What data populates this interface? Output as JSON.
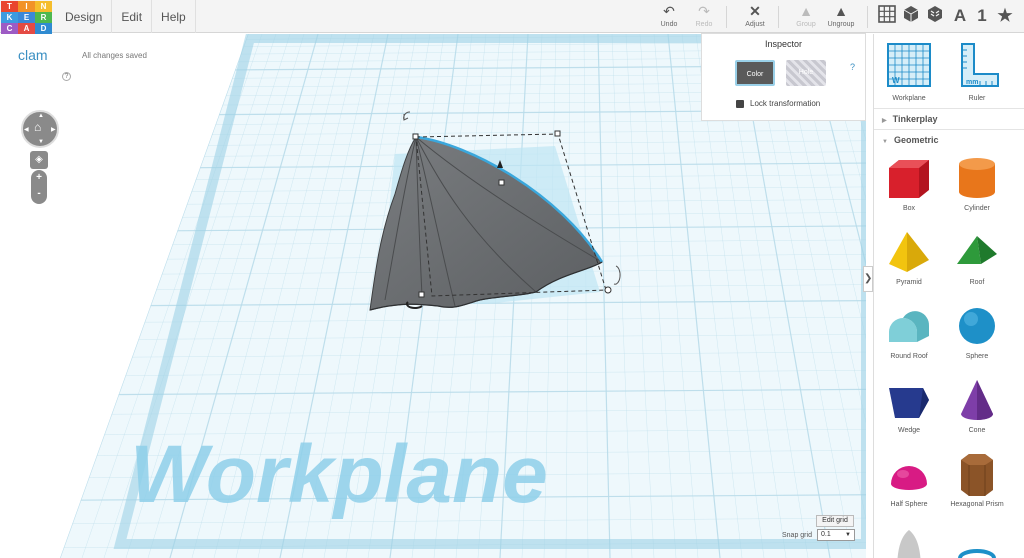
{
  "logo": {
    "letters": [
      "T",
      "I",
      "N",
      "K",
      "E",
      "R",
      "C",
      "A",
      "D"
    ],
    "colors": [
      "#e9462f",
      "#f29228",
      "#f5bd2c",
      "#3c9be0",
      "#3b88d8",
      "#4db84f",
      "#9d5bc4",
      "#e44b44",
      "#2f8bd1"
    ]
  },
  "menu": [
    "Design",
    "Edit",
    "Help"
  ],
  "toolbar": {
    "undo": {
      "icon": "↶",
      "label": "Undo"
    },
    "redo": {
      "icon": "↷",
      "label": "Redo"
    },
    "adjust": {
      "icon": "✕",
      "label": "Adjust"
    },
    "group": {
      "icon": "▲",
      "label": "Group"
    },
    "ungroup": {
      "icon": "▲",
      "label": "Ungroup"
    },
    "text_icon": "A",
    "number_icon": "1",
    "star_icon": "★"
  },
  "project": {
    "name": "clam",
    "status": "All changes saved"
  },
  "help_mark": "?",
  "zoom": {
    "plus": "+",
    "minus": "-"
  },
  "inspector": {
    "title": "Inspector",
    "color_label": "Color",
    "hole_label": "Hole",
    "help": "?",
    "lock_label": "Lock transformation"
  },
  "workplane_text": "Workplane",
  "grid": {
    "edit_label": "Edit grid",
    "snap_label": "Snap grid",
    "snap_value": "0.1"
  },
  "panel": {
    "tools": [
      {
        "name": "Workplane"
      },
      {
        "name": "Ruler"
      }
    ],
    "sections": [
      {
        "label": "Tinkerplay"
      },
      {
        "label": "Geometric"
      }
    ],
    "shapes": [
      "Box",
      "Cylinder",
      "Pyramid",
      "Roof",
      "Round Roof",
      "Sphere",
      "Wedge",
      "Cone",
      "Half Sphere",
      "Hexagonal Prism"
    ],
    "shape_colors": {
      "box": "#d8202c",
      "cylinder": "#e8761b",
      "pyramid": "#f2c40f",
      "roof": "#2e9a3b",
      "round_roof": "#7fcfd8",
      "sphere": "#1e90c8",
      "wedge": "#263a8e",
      "cone": "#7e3ea8",
      "half_sphere": "#d81b84",
      "hex_prism": "#8b5428"
    }
  },
  "colors": {
    "accent": "#3a8fc2",
    "grid_line": "#b9dcea",
    "shape": "#6b6e71"
  }
}
